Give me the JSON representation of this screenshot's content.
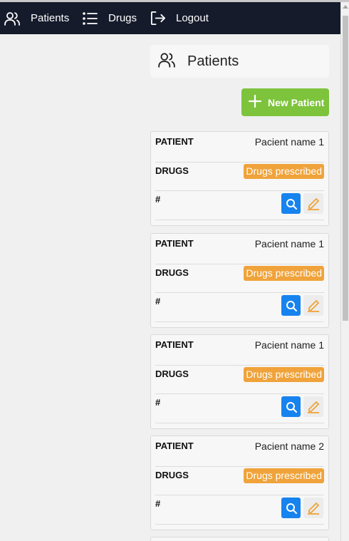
{
  "nav": {
    "patients_label": "Patients",
    "drugs_label": "Drugs",
    "logout_label": "Logout"
  },
  "header": {
    "title": "Patients"
  },
  "new_button": {
    "label": "New Patient"
  },
  "labels": {
    "patient": "PATIENT",
    "drugs": "DRUGS",
    "id": "#"
  },
  "patients": [
    {
      "name": "Pacient name 1",
      "drugs_badge": "Drugs prescribed"
    },
    {
      "name": "Pacient name 1",
      "drugs_badge": "Drugs prescribed"
    },
    {
      "name": "Pacient name 1",
      "drugs_badge": "Drugs prescribed"
    },
    {
      "name": "Pacient name 2",
      "drugs_badge": "Drugs prescribed"
    }
  ],
  "colors": {
    "navbar": "#161b2b",
    "new_button": "#7dc33b",
    "badge": "#f0a33a",
    "view_button": "#1783ef",
    "edit_icon": "#f0a33a"
  },
  "icons": {
    "patients": "users-icon",
    "drugs": "list-icon",
    "logout": "logout-icon",
    "new": "plus-icon",
    "view": "search-icon",
    "edit": "pencil-icon"
  }
}
